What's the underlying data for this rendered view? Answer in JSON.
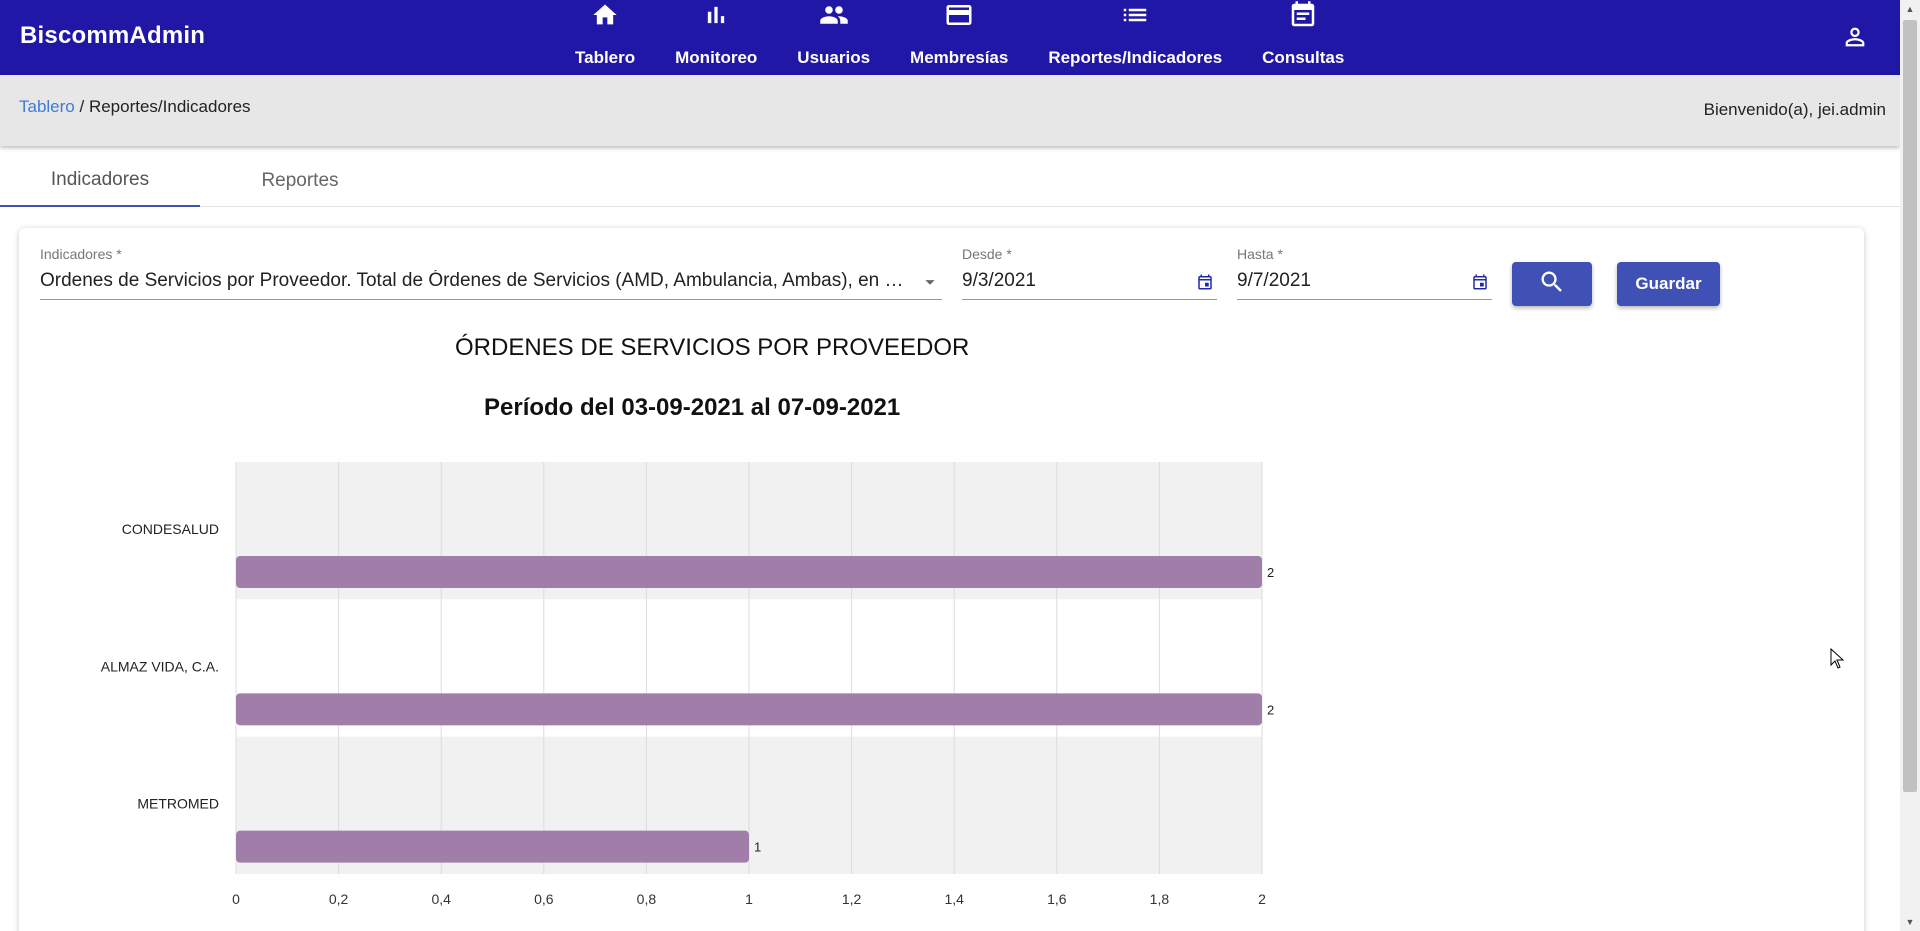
{
  "app": {
    "brand": "BiscommAdmin"
  },
  "nav": [
    {
      "label": "Tablero",
      "icon": "home-icon"
    },
    {
      "label": "Monitoreo",
      "icon": "bar-chart-icon"
    },
    {
      "label": "Usuarios",
      "icon": "people-icon"
    },
    {
      "label": "Membresías",
      "icon": "credit-card-icon"
    },
    {
      "label": "Reportes/Indicadores",
      "icon": "list-icon"
    },
    {
      "label": "Consultas",
      "icon": "event-note-icon"
    }
  ],
  "breadcrumb": {
    "link": "Tablero",
    "separator": " / ",
    "current": "Reportes/Indicadores"
  },
  "welcome": "Bienvenido(a), jei.admin",
  "tabs": [
    {
      "label": "Indicadores",
      "active": true
    },
    {
      "label": "Reportes",
      "active": false
    }
  ],
  "form": {
    "indicator_label": "Indicadores *",
    "indicator_value": "Ordenes de Servicios por Proveedor. Total de Órdenes de Servicios (AMD, Ambulancia, Ambas), en un período",
    "from_label": "Desde *",
    "from_value": "9/3/2021",
    "to_label": "Hasta *",
    "to_value": "9/7/2021",
    "save_label": "Guardar"
  },
  "colors": {
    "primary": "#2117a6",
    "accent": "#3f51b5",
    "bar": "#a17ea9",
    "link": "#3d7cd6"
  },
  "chart_data": {
    "type": "bar",
    "orientation": "horizontal",
    "title": "ÓRDENES DE SERVICIOS POR PROVEEDOR",
    "subtitle": "Período del 03-09-2021 al 07-09-2021",
    "categories": [
      "CONDESALUD",
      "ALMAZ VIDA, C.A.",
      "METROMED"
    ],
    "values": [
      2,
      2,
      1
    ],
    "data_labels": [
      "2",
      "2",
      "1"
    ],
    "xlim": [
      0,
      2
    ],
    "x_ticks": [
      "0",
      "0,2",
      "0,4",
      "0,6",
      "0,8",
      "1",
      "1,2",
      "1,4",
      "1,6",
      "1,8",
      "2"
    ],
    "grid": true
  }
}
